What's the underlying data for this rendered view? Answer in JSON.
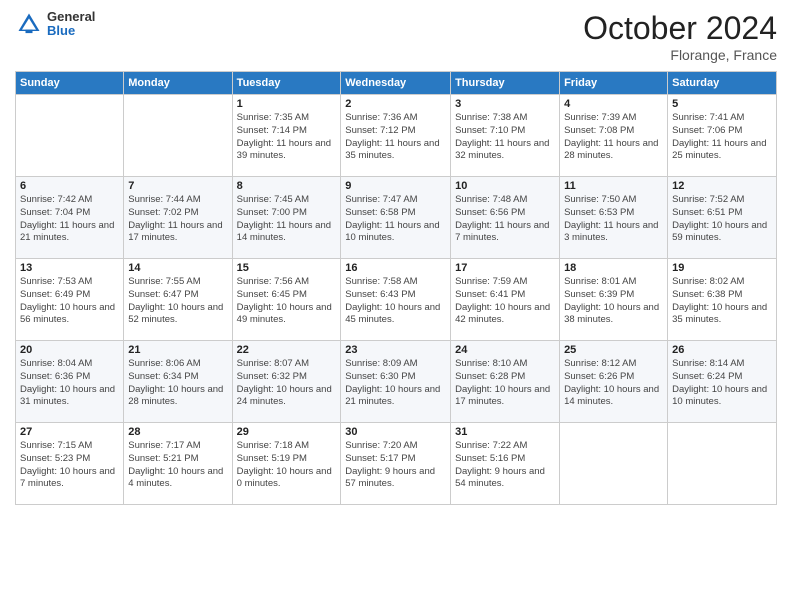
{
  "logo": {
    "general": "General",
    "blue": "Blue"
  },
  "header": {
    "month": "October 2024",
    "location": "Florange, France"
  },
  "days_of_week": [
    "Sunday",
    "Monday",
    "Tuesday",
    "Wednesday",
    "Thursday",
    "Friday",
    "Saturday"
  ],
  "weeks": [
    [
      {
        "day": "",
        "info": ""
      },
      {
        "day": "",
        "info": ""
      },
      {
        "day": "1",
        "info": "Sunrise: 7:35 AM\nSunset: 7:14 PM\nDaylight: 11 hours and 39 minutes."
      },
      {
        "day": "2",
        "info": "Sunrise: 7:36 AM\nSunset: 7:12 PM\nDaylight: 11 hours and 35 minutes."
      },
      {
        "day": "3",
        "info": "Sunrise: 7:38 AM\nSunset: 7:10 PM\nDaylight: 11 hours and 32 minutes."
      },
      {
        "day": "4",
        "info": "Sunrise: 7:39 AM\nSunset: 7:08 PM\nDaylight: 11 hours and 28 minutes."
      },
      {
        "day": "5",
        "info": "Sunrise: 7:41 AM\nSunset: 7:06 PM\nDaylight: 11 hours and 25 minutes."
      }
    ],
    [
      {
        "day": "6",
        "info": "Sunrise: 7:42 AM\nSunset: 7:04 PM\nDaylight: 11 hours and 21 minutes."
      },
      {
        "day": "7",
        "info": "Sunrise: 7:44 AM\nSunset: 7:02 PM\nDaylight: 11 hours and 17 minutes."
      },
      {
        "day": "8",
        "info": "Sunrise: 7:45 AM\nSunset: 7:00 PM\nDaylight: 11 hours and 14 minutes."
      },
      {
        "day": "9",
        "info": "Sunrise: 7:47 AM\nSunset: 6:58 PM\nDaylight: 11 hours and 10 minutes."
      },
      {
        "day": "10",
        "info": "Sunrise: 7:48 AM\nSunset: 6:56 PM\nDaylight: 11 hours and 7 minutes."
      },
      {
        "day": "11",
        "info": "Sunrise: 7:50 AM\nSunset: 6:53 PM\nDaylight: 11 hours and 3 minutes."
      },
      {
        "day": "12",
        "info": "Sunrise: 7:52 AM\nSunset: 6:51 PM\nDaylight: 10 hours and 59 minutes."
      }
    ],
    [
      {
        "day": "13",
        "info": "Sunrise: 7:53 AM\nSunset: 6:49 PM\nDaylight: 10 hours and 56 minutes."
      },
      {
        "day": "14",
        "info": "Sunrise: 7:55 AM\nSunset: 6:47 PM\nDaylight: 10 hours and 52 minutes."
      },
      {
        "day": "15",
        "info": "Sunrise: 7:56 AM\nSunset: 6:45 PM\nDaylight: 10 hours and 49 minutes."
      },
      {
        "day": "16",
        "info": "Sunrise: 7:58 AM\nSunset: 6:43 PM\nDaylight: 10 hours and 45 minutes."
      },
      {
        "day": "17",
        "info": "Sunrise: 7:59 AM\nSunset: 6:41 PM\nDaylight: 10 hours and 42 minutes."
      },
      {
        "day": "18",
        "info": "Sunrise: 8:01 AM\nSunset: 6:39 PM\nDaylight: 10 hours and 38 minutes."
      },
      {
        "day": "19",
        "info": "Sunrise: 8:02 AM\nSunset: 6:38 PM\nDaylight: 10 hours and 35 minutes."
      }
    ],
    [
      {
        "day": "20",
        "info": "Sunrise: 8:04 AM\nSunset: 6:36 PM\nDaylight: 10 hours and 31 minutes."
      },
      {
        "day": "21",
        "info": "Sunrise: 8:06 AM\nSunset: 6:34 PM\nDaylight: 10 hours and 28 minutes."
      },
      {
        "day": "22",
        "info": "Sunrise: 8:07 AM\nSunset: 6:32 PM\nDaylight: 10 hours and 24 minutes."
      },
      {
        "day": "23",
        "info": "Sunrise: 8:09 AM\nSunset: 6:30 PM\nDaylight: 10 hours and 21 minutes."
      },
      {
        "day": "24",
        "info": "Sunrise: 8:10 AM\nSunset: 6:28 PM\nDaylight: 10 hours and 17 minutes."
      },
      {
        "day": "25",
        "info": "Sunrise: 8:12 AM\nSunset: 6:26 PM\nDaylight: 10 hours and 14 minutes."
      },
      {
        "day": "26",
        "info": "Sunrise: 8:14 AM\nSunset: 6:24 PM\nDaylight: 10 hours and 10 minutes."
      }
    ],
    [
      {
        "day": "27",
        "info": "Sunrise: 7:15 AM\nSunset: 5:23 PM\nDaylight: 10 hours and 7 minutes."
      },
      {
        "day": "28",
        "info": "Sunrise: 7:17 AM\nSunset: 5:21 PM\nDaylight: 10 hours and 4 minutes."
      },
      {
        "day": "29",
        "info": "Sunrise: 7:18 AM\nSunset: 5:19 PM\nDaylight: 10 hours and 0 minutes."
      },
      {
        "day": "30",
        "info": "Sunrise: 7:20 AM\nSunset: 5:17 PM\nDaylight: 9 hours and 57 minutes."
      },
      {
        "day": "31",
        "info": "Sunrise: 7:22 AM\nSunset: 5:16 PM\nDaylight: 9 hours and 54 minutes."
      },
      {
        "day": "",
        "info": ""
      },
      {
        "day": "",
        "info": ""
      }
    ]
  ]
}
